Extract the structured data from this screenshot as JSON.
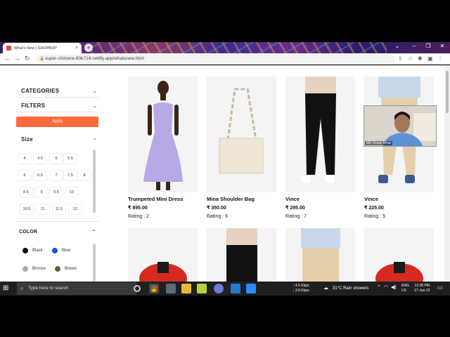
{
  "browser": {
    "tab_title": "What's New | SHOPBOP",
    "new_tab_symbol": "+",
    "close_symbol": "×",
    "url": "super-chimera-60b714.netlify.app/whatsnew.html",
    "window_controls": [
      "⌄",
      "–",
      "❐",
      "✕"
    ]
  },
  "sidebar": {
    "categories_label": "CATEGORIES",
    "filters_label": "FILTERS",
    "apply_label": "Apply",
    "size_label": "Size",
    "sizes": [
      "4",
      "4.5",
      "5",
      "5.5",
      "6",
      "6.5",
      "7",
      "7.5",
      "8",
      "8.5",
      "9",
      "9.5",
      "10",
      "10.5",
      "11",
      "11.5",
      "12"
    ],
    "color_label": "COLOR",
    "colors": [
      {
        "name": "Black",
        "hex": "#111111"
      },
      {
        "name": "Blue",
        "hex": "#1a53d6"
      },
      {
        "name": "Bronze",
        "hex": "#b8a89a"
      },
      {
        "name": "Brown",
        "hex": "#6b5a2a"
      }
    ]
  },
  "products": [
    {
      "name": "Trumpeted Mini Dress",
      "price": "₹ 895.00",
      "rating": "Rating : 2"
    },
    {
      "name": "Mina Shoulder Bag",
      "price": "₹ 350.00",
      "rating": "Rating : 6"
    },
    {
      "name": "Vince",
      "price": "₹ 295.00",
      "rating": "Rating : 7"
    },
    {
      "name": "Vince",
      "price": "₹ 225.00",
      "rating": "Rating : 5"
    }
  ],
  "webcam": {
    "name": "Md Owais Athar"
  },
  "taskbar": {
    "search_placeholder": "Type here to search",
    "net_up": "↑ 4.5 Kbps",
    "net_down": "↓ 3.9 Kbps",
    "weather": "31°C  Rain showers",
    "lang": "ENG",
    "region": "US",
    "time": "12:36 PM",
    "date": "17-Jun-22"
  },
  "accent_color": "#ff6a3d"
}
